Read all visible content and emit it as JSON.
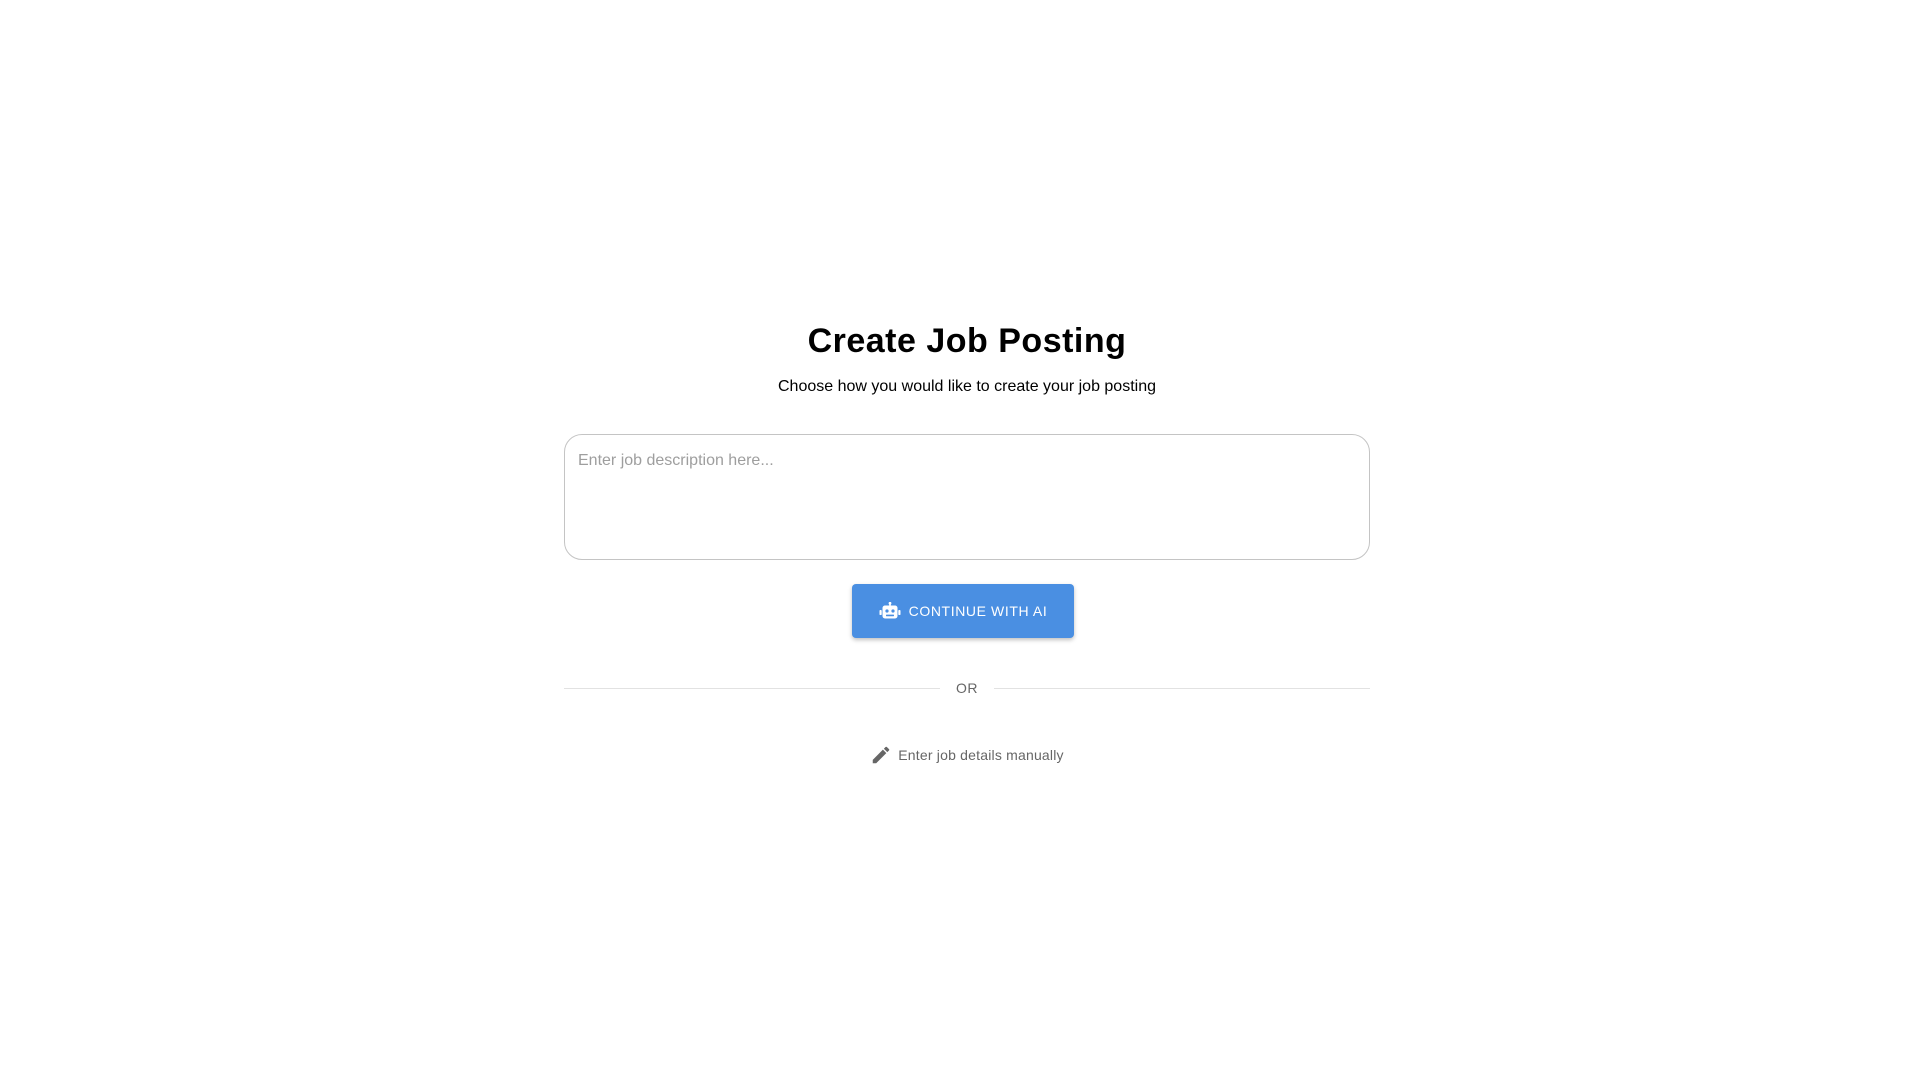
{
  "header": {
    "title": "Create Job Posting",
    "subtitle": "Choose how you would like to create your job posting"
  },
  "description_input": {
    "value": "",
    "placeholder": "Enter job description here..."
  },
  "ai_button": {
    "label": "CONTINUE WITH AI",
    "icon": "robot-icon",
    "color": "#4a8fe2"
  },
  "divider": {
    "label": "OR"
  },
  "manual_entry": {
    "label": "Enter job details manually",
    "icon": "pencil-icon"
  }
}
